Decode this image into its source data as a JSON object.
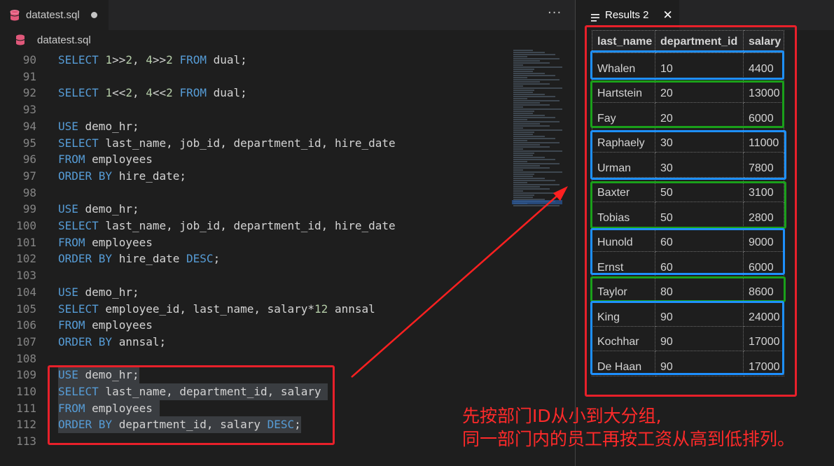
{
  "editor": {
    "tab_title": "datatest.sql",
    "breadcrumb": "datatest.sql",
    "more_actions": "···",
    "lines": [
      {
        "n": "90",
        "tokens": [
          [
            "kw",
            "SELECT "
          ],
          [
            "num",
            "1"
          ],
          [
            "t",
            ">>"
          ],
          [
            "num",
            "2"
          ],
          [
            "t",
            ", "
          ],
          [
            "num",
            "4"
          ],
          [
            "t",
            ">>"
          ],
          [
            "num",
            "2"
          ],
          [
            "t",
            " "
          ],
          [
            "kw",
            "FROM"
          ],
          [
            "t",
            " dual;"
          ]
        ]
      },
      {
        "n": "91",
        "tokens": []
      },
      {
        "n": "92",
        "tokens": [
          [
            "kw",
            "SELECT "
          ],
          [
            "num",
            "1"
          ],
          [
            "t",
            "<<"
          ],
          [
            "num",
            "2"
          ],
          [
            "t",
            ", "
          ],
          [
            "num",
            "4"
          ],
          [
            "t",
            "<<"
          ],
          [
            "num",
            "2"
          ],
          [
            "t",
            " "
          ],
          [
            "kw",
            "FROM"
          ],
          [
            "t",
            " dual;"
          ]
        ]
      },
      {
        "n": "93",
        "tokens": []
      },
      {
        "n": "94",
        "tokens": [
          [
            "kw",
            "USE"
          ],
          [
            "t",
            " demo_hr;"
          ]
        ]
      },
      {
        "n": "95",
        "tokens": [
          [
            "kw",
            "SELECT"
          ],
          [
            "t",
            " last_name, job_id, department_id, hire_date"
          ]
        ]
      },
      {
        "n": "96",
        "tokens": [
          [
            "kw",
            "FROM"
          ],
          [
            "t",
            " employees"
          ]
        ]
      },
      {
        "n": "97",
        "tokens": [
          [
            "kw",
            "ORDER BY"
          ],
          [
            "t",
            " hire_date;"
          ]
        ]
      },
      {
        "n": "98",
        "tokens": []
      },
      {
        "n": "99",
        "tokens": [
          [
            "kw",
            "USE"
          ],
          [
            "t",
            " demo_hr;"
          ]
        ]
      },
      {
        "n": "100",
        "tokens": [
          [
            "kw",
            "SELECT"
          ],
          [
            "t",
            " last_name, job_id, department_id, hire_date"
          ]
        ]
      },
      {
        "n": "101",
        "tokens": [
          [
            "kw",
            "FROM"
          ],
          [
            "t",
            " employees"
          ]
        ]
      },
      {
        "n": "102",
        "tokens": [
          [
            "kw",
            "ORDER BY"
          ],
          [
            "t",
            " hire_date "
          ],
          [
            "kw",
            "DESC"
          ],
          [
            "t",
            ";"
          ]
        ]
      },
      {
        "n": "103",
        "tokens": []
      },
      {
        "n": "104",
        "tokens": [
          [
            "kw",
            "USE"
          ],
          [
            "t",
            " demo_hr;"
          ]
        ]
      },
      {
        "n": "105",
        "tokens": [
          [
            "kw",
            "SELECT"
          ],
          [
            "t",
            " employee_id, last_name, salary*"
          ],
          [
            "num",
            "12"
          ],
          [
            "t",
            " annsal"
          ]
        ]
      },
      {
        "n": "106",
        "tokens": [
          [
            "kw",
            "FROM"
          ],
          [
            "t",
            " employees"
          ]
        ]
      },
      {
        "n": "107",
        "tokens": [
          [
            "kw",
            "ORDER BY"
          ],
          [
            "t",
            " annsal;"
          ]
        ]
      },
      {
        "n": "108",
        "tokens": []
      },
      {
        "n": "109",
        "selected": true,
        "tokens": [
          [
            "kw",
            "USE"
          ],
          [
            "t",
            " demo_hr;"
          ]
        ]
      },
      {
        "n": "110",
        "selected": true,
        "tokens": [
          [
            "kw",
            "SELECT"
          ],
          [
            "t",
            " last_name, department_id, salary "
          ]
        ]
      },
      {
        "n": "111",
        "selected": true,
        "tokens": [
          [
            "kw",
            "FROM"
          ],
          [
            "t",
            " employees "
          ]
        ]
      },
      {
        "n": "112",
        "selected": true,
        "tokens": [
          [
            "kw",
            "ORDER BY"
          ],
          [
            "t",
            " department_id, salary "
          ],
          [
            "kw",
            "DESC"
          ],
          [
            "t",
            ";"
          ]
        ]
      },
      {
        "n": "113",
        "tokens": []
      }
    ]
  },
  "results": {
    "tab_title": "Results 2",
    "close_icon": "✕",
    "columns": [
      "last_name",
      "department_id",
      "salary"
    ],
    "rows": [
      [
        "Whalen",
        "10",
        "4400"
      ],
      [
        "Hartstein",
        "20",
        "13000"
      ],
      [
        "Fay",
        "20",
        "6000"
      ],
      [
        "Raphaely",
        "30",
        "11000"
      ],
      [
        "Urman",
        "30",
        "7800"
      ],
      [
        "Baxter",
        "50",
        "3100"
      ],
      [
        "Tobias",
        "50",
        "2800"
      ],
      [
        "Hunold",
        "60",
        "9000"
      ],
      [
        "Ernst",
        "60",
        "6000"
      ],
      [
        "Taylor",
        "80",
        "8600"
      ],
      [
        "King",
        "90",
        "24000"
      ],
      [
        "Kochhar",
        "90",
        "17000"
      ],
      [
        "De Haan",
        "90",
        "17000"
      ]
    ]
  },
  "annotation": {
    "caption_line1": "先按部门ID从小到大分组,",
    "caption_line2": "同一部门内的员工再按工资从高到低排列。",
    "color_red": "#e8202a",
    "color_blue": "#1e90ff",
    "color_green": "#1aa01a"
  },
  "colors": {
    "editor_bg": "#1e1e1e",
    "keyword": "#569cd6",
    "number": "#b5cea8",
    "selection": "#3a3d41"
  }
}
